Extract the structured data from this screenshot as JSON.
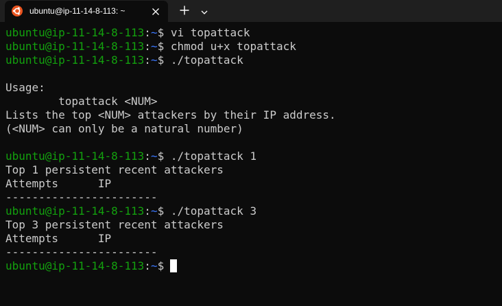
{
  "window": {
    "tab_title": "ubuntu@ip-11-14-8-113: ~",
    "tab_icon": "ubuntu-icon",
    "accent_color": "#e95420"
  },
  "prompt": {
    "user_host": "ubuntu@ip-11-14-8-113",
    "colon": ":",
    "path": "~",
    "symbol": "$"
  },
  "colors": {
    "background": "#0c0c0c",
    "user_host": "#13a10e",
    "path": "#3b78ff",
    "text": "#cccccc"
  },
  "lines": [
    {
      "type": "prompt",
      "command": " vi topattack"
    },
    {
      "type": "prompt",
      "command": " chmod u+x topattack"
    },
    {
      "type": "prompt",
      "command": " ./topattack"
    },
    {
      "type": "text",
      "text": ""
    },
    {
      "type": "text",
      "text": "Usage:"
    },
    {
      "type": "text",
      "text": "        topattack <NUM>"
    },
    {
      "type": "text",
      "text": "Lists the top <NUM> attackers by their IP address."
    },
    {
      "type": "text",
      "text": "(<NUM> can only be a natural number)"
    },
    {
      "type": "text",
      "text": ""
    },
    {
      "type": "prompt",
      "command": " ./topattack 1"
    },
    {
      "type": "text",
      "text": "Top 1 persistent recent attackers"
    },
    {
      "type": "text",
      "text": "Attempts      IP"
    },
    {
      "type": "text",
      "text": "-----------------------"
    },
    {
      "type": "prompt",
      "command": " ./topattack 3"
    },
    {
      "type": "text",
      "text": "Top 3 persistent recent attackers"
    },
    {
      "type": "text",
      "text": "Attempts      IP"
    },
    {
      "type": "text",
      "text": "-----------------------"
    },
    {
      "type": "prompt_cursor",
      "command": ""
    }
  ]
}
